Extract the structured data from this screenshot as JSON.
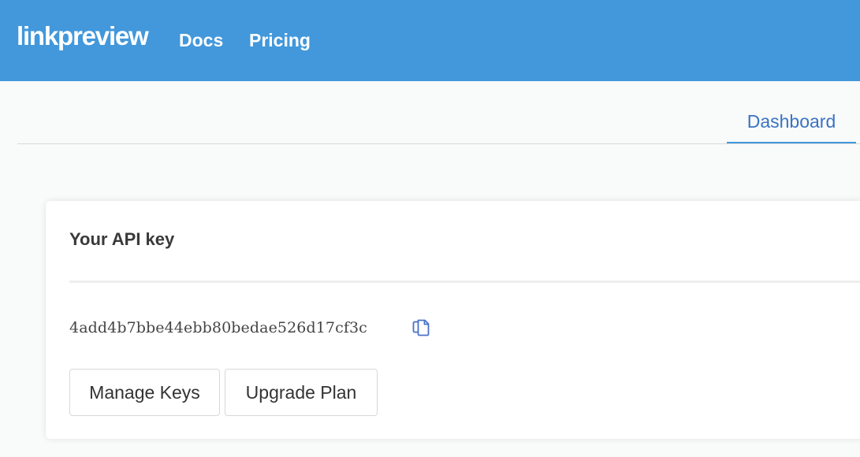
{
  "navbar": {
    "brand": "linkpreview",
    "links": [
      "Docs",
      "Pricing"
    ],
    "color": "#4298db"
  },
  "tabs": {
    "active": "Dashboard",
    "accent_color": "#3a73c4"
  },
  "api_card": {
    "title": "Your API key",
    "key": "4add4b7bbe44ebb80bedae526d17cf3c",
    "copy_icon": "copy-icon",
    "buttons": {
      "manage": "Manage Keys",
      "upgrade": "Upgrade Plan"
    }
  }
}
